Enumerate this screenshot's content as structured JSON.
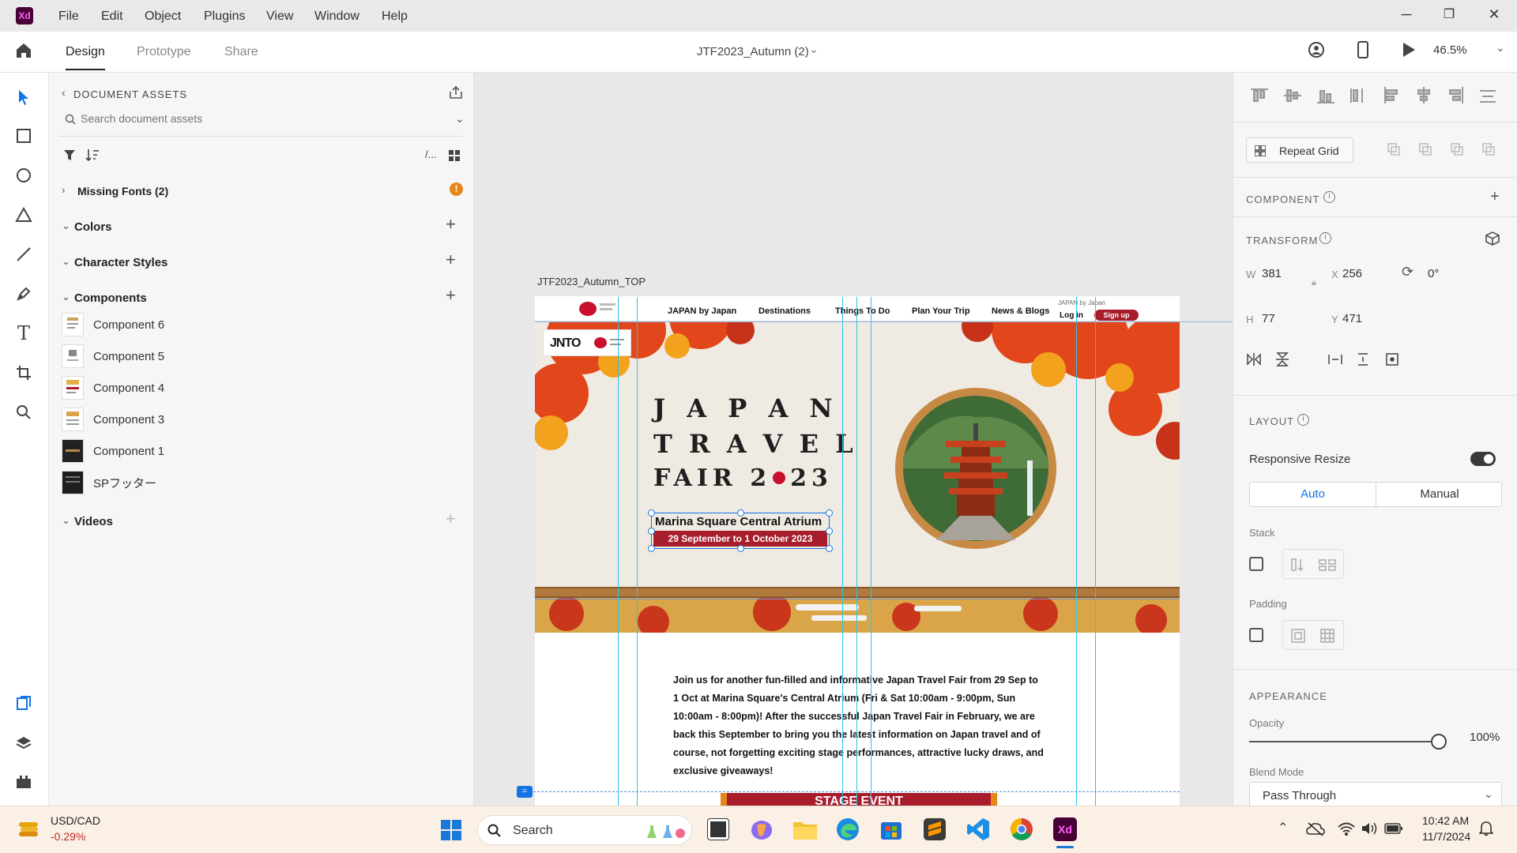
{
  "menu": [
    "File",
    "Edit",
    "Object",
    "Plugins",
    "View",
    "Window",
    "Help"
  ],
  "app_logo": "Xd",
  "modes": {
    "design": "Design",
    "prototype": "Prototype",
    "share": "Share"
  },
  "document_title": "JTF2023_Autumn (2)",
  "zoom": "46.5%",
  "assets": {
    "header": "DOCUMENT ASSETS",
    "search_placeholder": "Search document assets",
    "sections": {
      "missing_fonts": "Missing Fonts (2)",
      "colors": "Colors",
      "character_styles": "Character Styles",
      "components": "Components",
      "videos": "Videos"
    },
    "components": [
      "Component 6",
      "Component 5",
      "Component 4",
      "Component 3",
      "Component 1",
      "SPフッター"
    ]
  },
  "artboard": {
    "name": "JTF2023_Autumn_TOP",
    "nav": {
      "items": [
        "JAPAN by Japan",
        "Destinations",
        "Things To Do",
        "Plan Your Trip",
        "News & Blogs"
      ],
      "tagline": "JAPAN by Japan",
      "login": "Log in",
      "signup": "Sign up"
    },
    "logo_text": "JNTO",
    "hero": {
      "title_line1": "J A P A N",
      "title_line2": "T R A V E L",
      "title_line3_left": "FAIR 2",
      "title_line3_right": "23",
      "venue": "Marina Square Central Atrium",
      "dates": "29 September to 1 October 2023"
    },
    "intro": "Join us for another fun-filled and informative Japan Travel Fair from 29 Sep to 1 Oct at Marina Square's Central Atrium (Fri & Sat 10:00am - 9:00pm, Sun 10:00am - 8:00pm)! After the successful Japan Travel Fair in February, we are back this September to bring you the latest information on Japan travel and of course, not forgetting exciting stage performances, attractive lucky draws, and exclusive giveaways!",
    "stage_banner": "STAGE EVENT"
  },
  "properties": {
    "repeat_grid": "Repeat Grid",
    "component_label": "COMPONENT",
    "transform_label": "TRANSFORM",
    "w": "381",
    "x": "256",
    "h": "77",
    "y": "471",
    "rotation": "0°",
    "layout_label": "LAYOUT",
    "responsive_resize": "Responsive Resize",
    "auto": "Auto",
    "manual": "Manual",
    "stack": "Stack",
    "padding": "Padding",
    "appearance_label": "APPEARANCE",
    "opacity_label": "Opacity",
    "opacity_value": "100%",
    "opacity_level": 1.0,
    "blend_mode_label": "Blend Mode",
    "blend_mode": "Pass Through"
  },
  "taskbar": {
    "stock_name": "USD/CAD",
    "stock_change": "-0.29%",
    "search": "Search",
    "time": "10:42 AM",
    "date": "11/7/2024"
  },
  "colors": {
    "accent": "#1473e6",
    "brand_red": "#a81d2b",
    "xd_purple": "#470137",
    "guide": "#26c6e8"
  }
}
